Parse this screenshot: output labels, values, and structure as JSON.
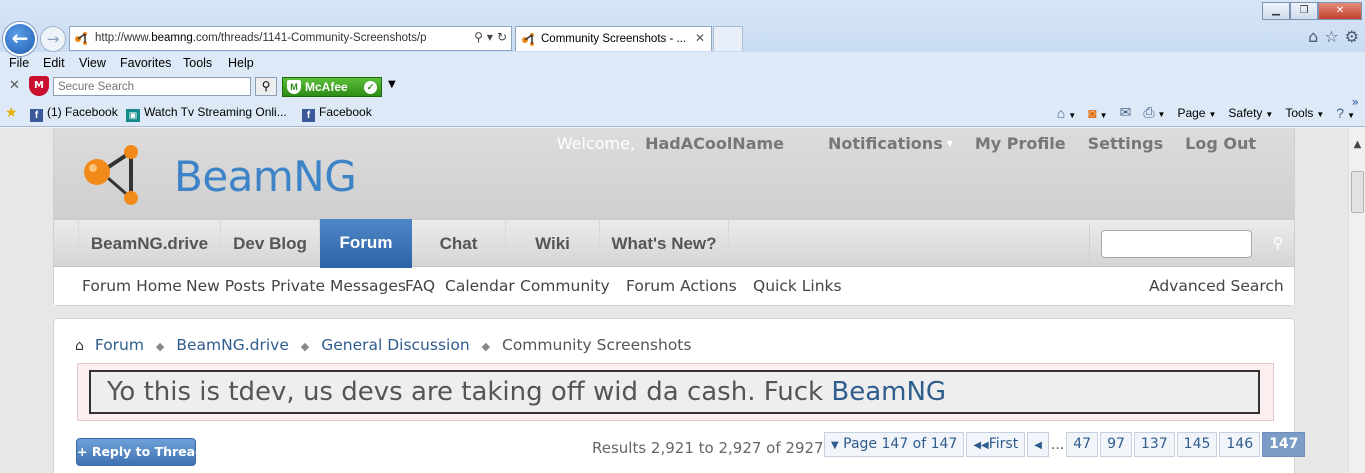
{
  "browser": {
    "address_url_prefix": "http://www.",
    "address_url_host": "beamng",
    "address_url_rest": ".com/threads/1141-Community-Screenshots/p",
    "tab_title": "Community Screenshots - ...",
    "tab_close": "✕",
    "menu": [
      "File",
      "Edit",
      "View",
      "Favorites",
      "Tools",
      "Help"
    ],
    "mcafee_search_placeholder": "Secure Search",
    "mcafee_badge": "McAfee",
    "favorites": [
      {
        "label": "(1) Facebook",
        "icon": "facebook-icon"
      },
      {
        "label": "Watch Tv Streaming Onli...",
        "icon": "tv-icon"
      },
      {
        "label": "Facebook",
        "icon": "facebook-icon"
      }
    ],
    "command_bar": {
      "page": "Page",
      "safety": "Safety",
      "tools": "Tools"
    }
  },
  "site": {
    "logo_text": "BeamNG",
    "user_nav": {
      "welcome": "Welcome,",
      "username": "HadACoolName",
      "notifications": "Notifications",
      "my_profile": "My Profile",
      "settings": "Settings",
      "log_out": "Log Out"
    },
    "nav_tabs": [
      {
        "label": "BeamNG.drive",
        "active": false
      },
      {
        "label": "Dev Blog",
        "active": false
      },
      {
        "label": "Forum",
        "active": true
      },
      {
        "label": "Chat",
        "active": false
      },
      {
        "label": "Wiki",
        "active": false
      },
      {
        "label": "What's New?",
        "active": false
      }
    ],
    "sub_nav": [
      "Forum Home",
      "New Posts",
      "Private Messages",
      "FAQ",
      "Calendar",
      "Community",
      "Forum Actions",
      "Quick Links"
    ],
    "advanced_search": "Advanced Search",
    "search_value": ""
  },
  "content": {
    "breadcrumb": [
      "Forum",
      "BeamNG.drive",
      "General Discussion"
    ],
    "breadcrumb_current": "Community Screenshots",
    "thread_title_text": "Yo this is tdev, us devs are taking off wid da cash. Fuck ",
    "thread_title_brand": "BeamNG",
    "reply_button": "+ Reply to Thread",
    "results": "Results 2,921 to 2,927 of 2927",
    "pager": {
      "page_of": "Page 147 of 147",
      "first": "First",
      "ellipsis": "...",
      "pages": [
        "47",
        "97",
        "137",
        "145",
        "146"
      ],
      "current": "147"
    }
  },
  "colors": {
    "brand_blue": "#3d83c7",
    "link_blue": "#2f5c8e",
    "active_tab": "#2e63a6"
  }
}
